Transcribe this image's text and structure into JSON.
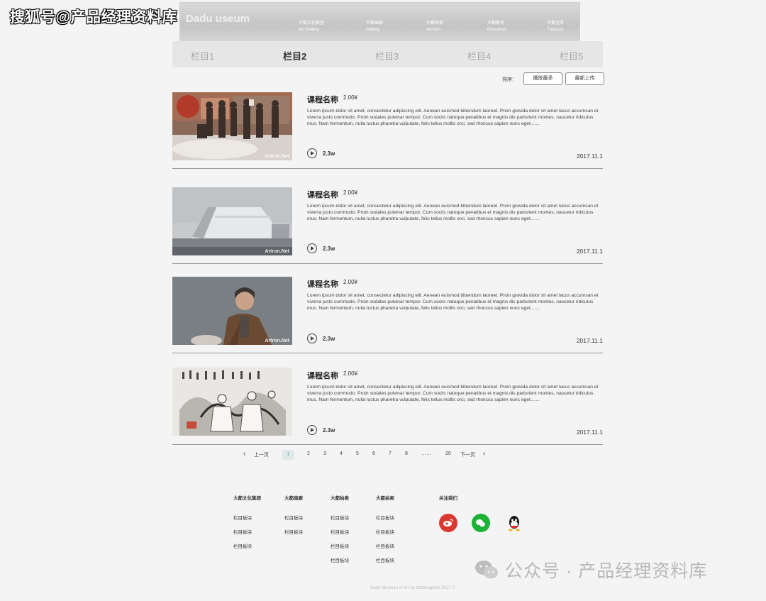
{
  "watermark_top": "搜狐号@产品经理资料库",
  "header": {
    "logo": "Dadu useum",
    "nav": [
      {
        "cn": "大都文化集团",
        "en": "Art Gallery"
      },
      {
        "cn": "大都画廊",
        "en": "Gallery"
      },
      {
        "cn": "大都拍卖",
        "en": "Auction"
      },
      {
        "cn": "大都教育",
        "en": "Education"
      },
      {
        "cn": "大都宝库",
        "en": "Treasury"
      }
    ]
  },
  "tabs": [
    "栏目1",
    "栏目2",
    "栏目3",
    "栏目4",
    "栏目5"
  ],
  "active_tab": "栏目2",
  "sort": {
    "label": "排序：",
    "buttons": [
      "播放最多",
      "最新上传"
    ]
  },
  "courses": [
    {
      "title": "课程名称",
      "price": "2.00¥",
      "desc": "Lorem ipsum dolor sit amet, consectetur adipiscing elit. Aenean euismod bibendum laoreet. Proin gravida dolor sit amet lacus accumsan et viverra justo commodo. Proin sodales pulvinar tempor. Cum sociis natoque penatibus et magnis dis parturient montes, nascetur ridiculus mus. Nam fermentum, nulla luctus pharetra vulputate, felis tellus mollis orci, sed rhoncus sapien nunc eget.......",
      "plays": "2.3w",
      "date": "2017.11.1",
      "img_wm": "Artron.Net"
    },
    {
      "title": "课程名称",
      "price": "2.00¥",
      "desc": "Lorem ipsum dolor sit amet, consectetur adipiscing elit. Aenean euismod bibendum laoreet. Proin gravida dolor sit amet lacus accumsan et viverra justo commodo. Proin sodales pulvinar tempor. Cum sociis natoque penatibus et magnis dis parturient montes, nascetur ridiculus mus. Nam fermentum, nulla luctus pharetra vulputate, felis tellus mollis orci, sed rhoncus sapien nunc eget.......",
      "plays": "2.3w",
      "date": "2017.11.1",
      "img_wm": "Artron.Net"
    },
    {
      "title": "课程名称",
      "price": "2.00¥",
      "desc": "Lorem ipsum dolor sit amet, consectetur adipiscing elit. Aenean euismod bibendum laoreet. Proin gravida dolor sit amet lacus accumsan et viverra justo commodo. Proin sodales pulvinar tempor. Cum sociis natoque penatibus et magnis dis parturient montes, nascetur ridiculus mus. Nam fermentum, nulla luctus pharetra vulputate, felis tellus mollis orci, sed rhoncus sapien nunc eget.......",
      "plays": "2.3w",
      "date": "2017.11.1",
      "img_wm": "Artron.Net"
    },
    {
      "title": "课程名称",
      "price": "2.00¥",
      "desc": "Lorem ipsum dolor sit amet, consectetur adipiscing elit. Aenean euismod bibendum laoreet. Proin gravida dolor sit amet lacus accumsan et viverra justo commodo. Proin sodales pulvinar tempor. Cum sociis natoque penatibus et magnis dis parturient montes, nascetur ridiculus mus. Nam fermentum, nulla luctus pharetra vulputate, felis tellus mollis orci, sed rhoncus sapien nunc eget.......",
      "plays": "2.3w",
      "date": "2017.11.1",
      "img_wm": ""
    }
  ],
  "pagination": {
    "prev": "上一页",
    "pages": [
      "1",
      "2",
      "3",
      "4",
      "5",
      "6",
      "7",
      "8"
    ],
    "ellipsis": "……",
    "last": "20",
    "next": "下一页",
    "current": "1"
  },
  "footer": {
    "columns": [
      {
        "head": "大都文化集团",
        "items": [
          "栏目板块",
          "栏目板块",
          "栏目板块"
        ]
      },
      {
        "head": "大都画廊",
        "items": [
          "栏目板块",
          "栏目板块"
        ]
      },
      {
        "head": "大都拍卖",
        "items": [
          "栏目板块",
          "栏目板块",
          "栏目板块",
          "栏目板块"
        ]
      },
      {
        "head": "大都拍卖",
        "items": [
          "栏目板块",
          "栏目板块",
          "栏目板块",
          "栏目板块"
        ]
      }
    ],
    "follow": "关注我们",
    "copyright": "Dadu Museum of Art by dazhengtech 2017 ©"
  },
  "watermark_bottom": "公众号 · 产品经理资料库",
  "colors": {
    "weibo": "#d83a32",
    "wechat": "#1db234",
    "accent_current_page": "#dfe9ea"
  }
}
